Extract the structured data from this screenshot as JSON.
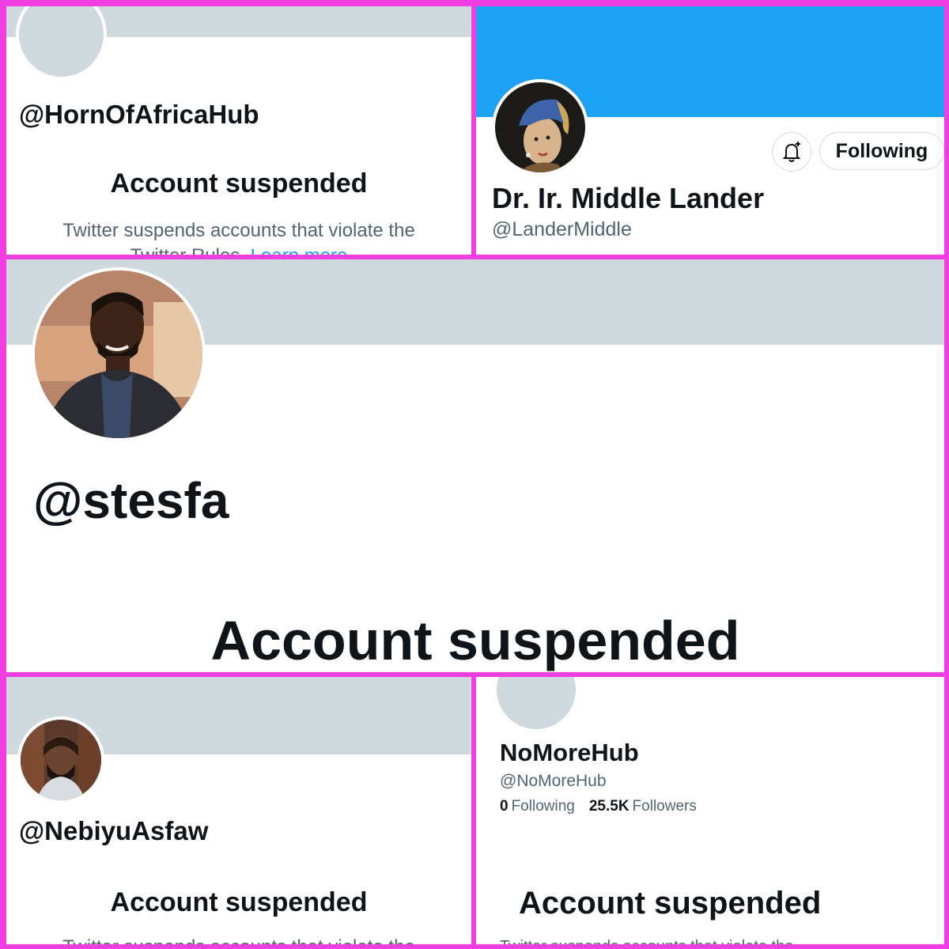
{
  "panels": {
    "horn": {
      "handle": "@HornOfAfricaHub",
      "title": "Account suspended",
      "body_text": "Twitter suspends accounts that violate the",
      "body_text_2": "Twitter Rules.",
      "learn_more": "Learn more"
    },
    "lander": {
      "display_name": "Dr. Ir. Middle Lander",
      "handle": "@LanderMiddle",
      "following_label": "Following",
      "banner_color": "#1da1f2"
    },
    "stesfa": {
      "handle": "@stesfa",
      "title": "Account suspended"
    },
    "nebiyu": {
      "handle": "@NebiyuAsfaw",
      "title": "Account suspended",
      "body_text": "Twitter suspends accounts that violate the"
    },
    "nomore": {
      "display_name": "NoMoreHub",
      "handle": "@NoMoreHub",
      "following_count": "0",
      "following_label": "Following",
      "followers_count": "25.5K",
      "followers_label": "Followers",
      "title": "Account suspended",
      "body_text": "Twitter suspends accounts that violate the"
    }
  },
  "colors": {
    "border": "#f03ee0",
    "banner_gray": "#cfd9de",
    "link": "#1d9bf0"
  },
  "icons": {
    "bell": "bell-plus-icon"
  }
}
